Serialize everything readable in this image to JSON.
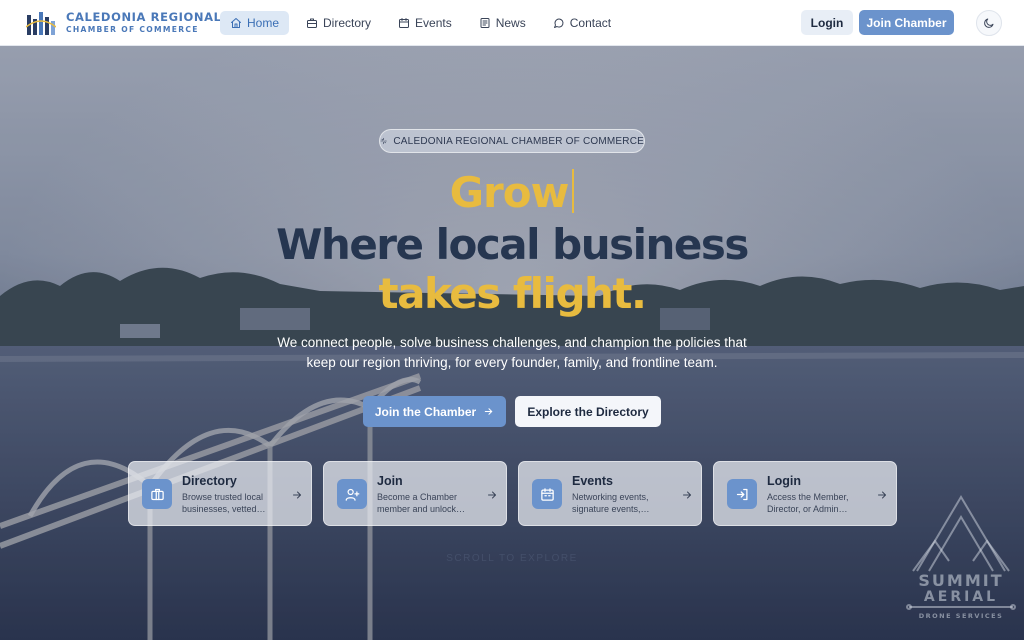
{
  "brand": {
    "title": "CALEDONIA REGIONAL",
    "subtitle": "CHAMBER OF COMMERCE"
  },
  "nav": {
    "items": [
      {
        "label": "Home",
        "icon": "home-icon",
        "active": true
      },
      {
        "label": "Directory",
        "icon": "building-icon",
        "active": false
      },
      {
        "label": "Events",
        "icon": "calendar-icon",
        "active": false
      },
      {
        "label": "News",
        "icon": "newspaper-icon",
        "active": false
      },
      {
        "label": "Contact",
        "icon": "chat-bubble-icon",
        "active": false
      }
    ]
  },
  "header_actions": {
    "login_label": "Login",
    "join_label": "Join Chamber",
    "theme_icon": "moon-icon"
  },
  "hero": {
    "pill_label": "CALEDONIA REGIONAL CHAMBER OF COMMERCE",
    "headline_typed": "Grow",
    "headline_line2": "Where local business",
    "headline_line3": "takes flight.",
    "subtext": "We connect people, solve business challenges, and champion the policies that keep our region thriving, for every founder, family, and frontline team.",
    "cta_primary": "Join the Chamber",
    "cta_secondary": "Explore the Directory",
    "scroll_hint": "SCROLL TO EXPLORE"
  },
  "cards": [
    {
      "title": "Directory",
      "description": "Browse trusted local businesses, vetted…",
      "icon": "briefcase-icon"
    },
    {
      "title": "Join",
      "description": "Become a Chamber member and unlock…",
      "icon": "user-plus-icon"
    },
    {
      "title": "Events",
      "description": "Networking events, signature events,…",
      "icon": "calendar-icon"
    },
    {
      "title": "Login",
      "description": "Access the Member, Director, or Admin…",
      "icon": "login-icon"
    }
  ],
  "watermark": {
    "line1": "SUMMIT",
    "line2": "AERIAL",
    "line3": "DRONE SERVICES"
  },
  "colors": {
    "accent": "#6b93cc",
    "gold": "#e8bb3f",
    "navy": "#263650",
    "brand_blue": "#4a78b8"
  }
}
